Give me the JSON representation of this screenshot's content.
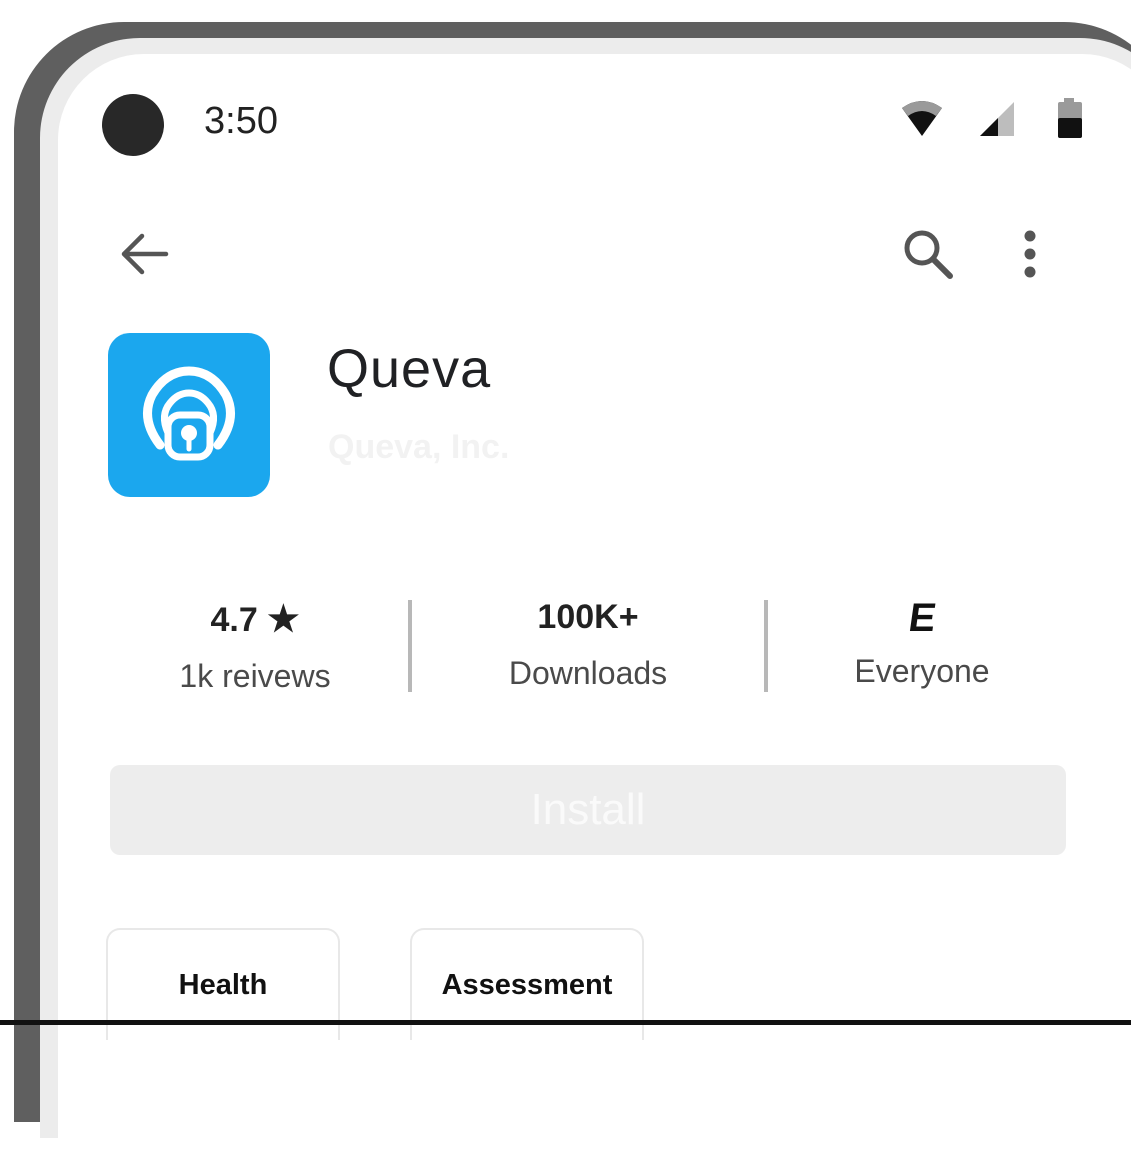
{
  "status_bar": {
    "time": "3:50"
  },
  "icons": {
    "back": "arrow-back-icon",
    "search": "search-icon",
    "more": "more-vert-icon",
    "wifi": "wifi-icon",
    "signal": "signal-icon",
    "battery": "battery-icon"
  },
  "app": {
    "name": "Queva",
    "developer": "Queva, Inc.",
    "icon_color": "#1ba7ee"
  },
  "stats": {
    "rating": {
      "value": "4.7",
      "star": "★",
      "label": "1k reivews"
    },
    "downloads": {
      "value": "100K+",
      "label": "Downloads"
    },
    "content_rating": {
      "badge": "E",
      "label": "Everyone"
    }
  },
  "install": {
    "label": "Install"
  },
  "tags": [
    "Health",
    "Assessment"
  ]
}
